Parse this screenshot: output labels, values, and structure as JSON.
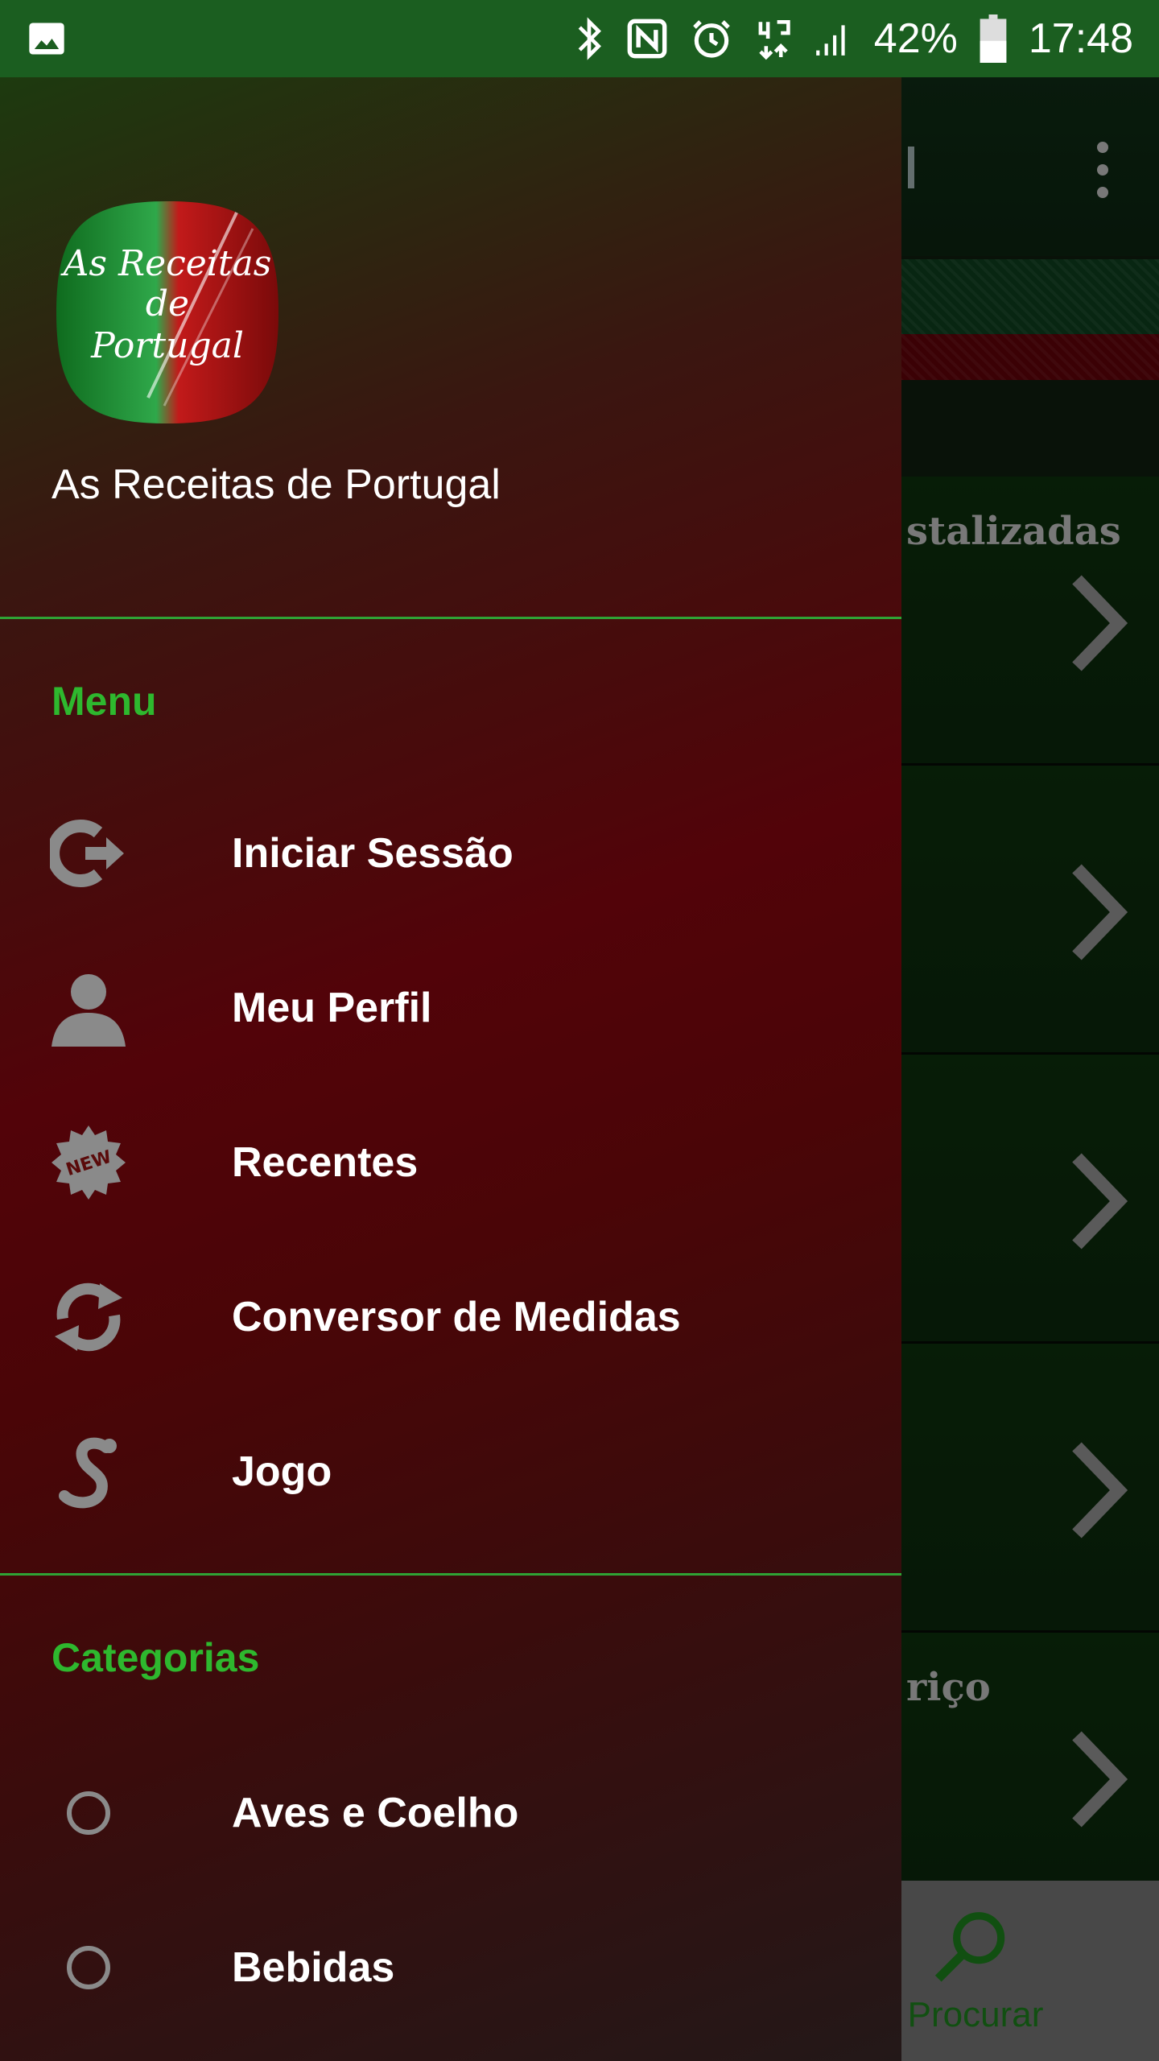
{
  "status_bar": {
    "battery_percent": "42%",
    "time": "17:48",
    "icons": [
      "image-icon",
      "bluetooth-icon",
      "nfc-icon",
      "alarm-icon",
      "data-4g-icon",
      "signal-icon",
      "battery-icon"
    ]
  },
  "background": {
    "rows": [
      {
        "title": "stalizadas"
      },
      {
        "title": ""
      },
      {
        "title": ""
      },
      {
        "title": ""
      },
      {
        "title": "riço"
      }
    ],
    "bottom_nav": {
      "search_label": "Procurar"
    }
  },
  "drawer": {
    "app_name": "As Receitas de Portugal",
    "logo_text": [
      "As Receitas",
      "de",
      "Portugal"
    ],
    "menu_section": "Menu",
    "menu_items": [
      {
        "label": "Iniciar Sessão",
        "icon": "login-icon"
      },
      {
        "label": "Meu Perfil",
        "icon": "profile-icon"
      },
      {
        "label": "Recentes",
        "icon": "new-badge-icon"
      },
      {
        "label": "Conversor de Medidas",
        "icon": "refresh-icon"
      },
      {
        "label": "Jogo",
        "icon": "snake-icon"
      }
    ],
    "categories_section": "Categorias",
    "categories": [
      {
        "label": "Aves e Coelho",
        "icon": "radio-icon"
      },
      {
        "label": "Bebidas",
        "icon": "radio-icon"
      }
    ]
  },
  "colors": {
    "status_bar": "#1b5e20",
    "accent": "#2eb82e",
    "drawer_red": "#520309"
  }
}
